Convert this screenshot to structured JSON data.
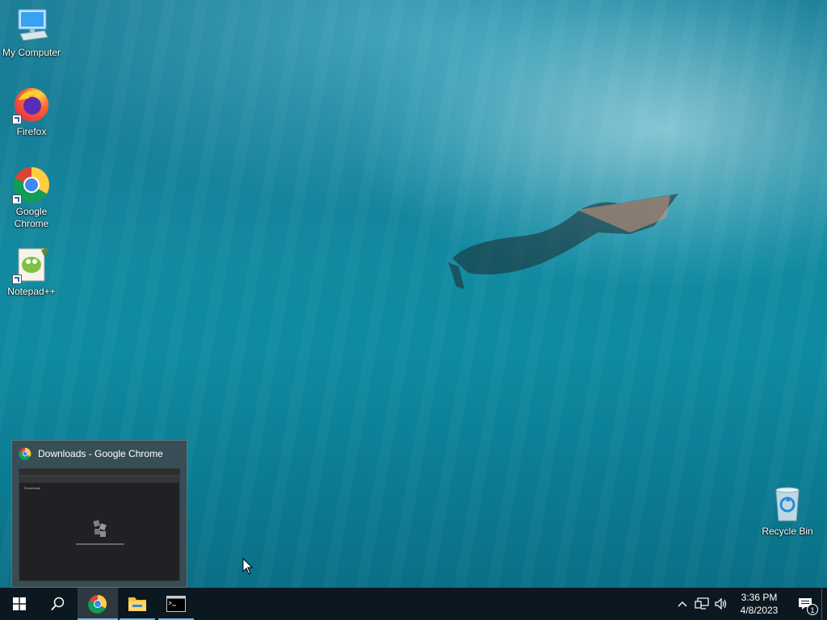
{
  "desktop": {
    "icons": [
      {
        "label": "My Computer",
        "icon": "computer-icon"
      },
      {
        "label": "Firefox",
        "icon": "firefox-icon"
      },
      {
        "label": "Google Chrome",
        "icon": "chrome-icon"
      },
      {
        "label": "Notepad++",
        "icon": "notepadpp-icon"
      },
      {
        "label": "Recycle Bin",
        "icon": "recycle-bin-icon"
      }
    ]
  },
  "preview": {
    "title": "Downloads - Google Chrome",
    "page_title": "Downloads"
  },
  "taskbar": {
    "start": "windows-start-icon",
    "search": "search-icon",
    "apps": [
      {
        "name": "Google Chrome",
        "icon": "chrome-icon",
        "active": true
      },
      {
        "name": "File Explorer",
        "icon": "folder-icon",
        "active": false
      },
      {
        "name": "Command Prompt",
        "icon": "terminal-icon",
        "active": false
      }
    ],
    "clock": {
      "time": "3:36 PM",
      "date": "4/8/2023"
    },
    "notifications_count": "1"
  },
  "colors": {
    "taskbar": "#0c1820",
    "accent": "#76b9ed"
  }
}
